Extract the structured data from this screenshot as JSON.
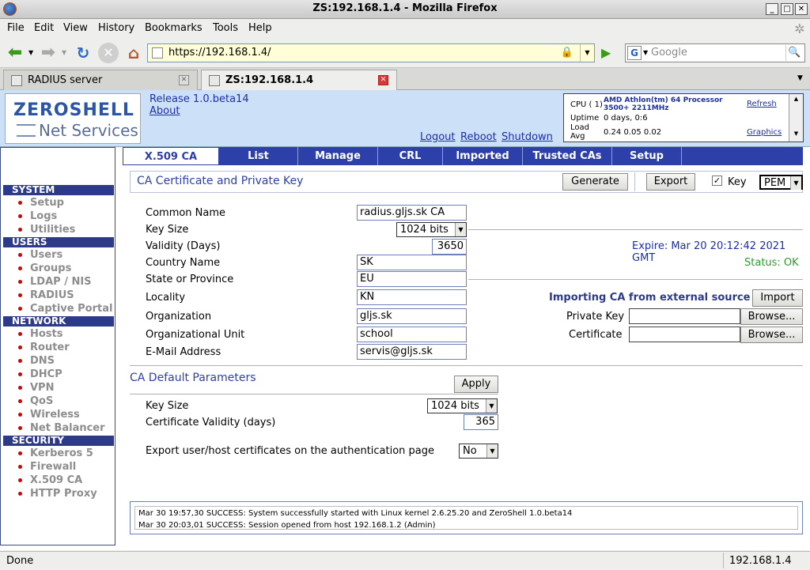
{
  "window": {
    "title": "ZS:192.168.1.4 - Mozilla Firefox"
  },
  "menubar": [
    "File",
    "Edit",
    "View",
    "History",
    "Bookmarks",
    "Tools",
    "Help"
  ],
  "navbar": {
    "url": "https://192.168.1.4/",
    "search_placeholder": "Google"
  },
  "tabs": [
    {
      "label": "RADIUS server"
    },
    {
      "label": "ZS:192.168.1.4"
    }
  ],
  "header": {
    "logo_line1": "ZEROSHELL",
    "logo_line2": "Net Services",
    "release": "Release 1.0.beta14",
    "about": "About",
    "logout": "Logout",
    "reboot": "Reboot",
    "shutdown": "Shutdown",
    "cpu_label": "CPU ( 1)",
    "cpu_value": "AMD Athlon(tm) 64 Processor 3500+ 2211MHz",
    "uptime_label": "Uptime",
    "uptime_value": "0 days, 0:6",
    "load_label": "Load Avg",
    "load_value": "0.24 0.05 0.02",
    "refresh": "Refresh",
    "graphics": "Graphics"
  },
  "sidebar": {
    "sections": [
      {
        "title": "SYSTEM",
        "items": [
          "Setup",
          "Logs",
          "Utilities"
        ]
      },
      {
        "title": "USERS",
        "items": [
          "Users",
          "Groups",
          "LDAP / NIS",
          "RADIUS",
          "Captive Portal"
        ]
      },
      {
        "title": "NETWORK",
        "items": [
          "Hosts",
          "Router",
          "DNS",
          "DHCP",
          "VPN",
          "QoS",
          "Wireless",
          "Net Balancer"
        ]
      },
      {
        "title": "SECURITY",
        "items": [
          "Kerberos 5",
          "Firewall",
          "X.509 CA",
          "HTTP Proxy"
        ]
      }
    ]
  },
  "ca_tabs": [
    "X.509 CA",
    "List",
    "Manage",
    "CRL",
    "Imported",
    "Trusted CAs",
    "Setup"
  ],
  "ca_section": {
    "title": "CA Certificate and Private Key",
    "generate": "Generate",
    "export": "Export",
    "key_label": "Key",
    "key_checked": "✓",
    "format": "PEM"
  },
  "form": {
    "common_name_label": "Common Name",
    "common_name": "radius.gljs.sk CA",
    "key_size_label": "Key Size",
    "key_size": "1024 bits",
    "validity_label": "Validity (Days)",
    "validity": "3650",
    "country_label": "Country Name",
    "country": "SK",
    "state_label": "State or Province",
    "state": "EU",
    "locality_label": "Locality",
    "locality": "KN",
    "org_label": "Organization",
    "org": "gljs.sk",
    "org_unit_label": "Organizational Unit",
    "org_unit": "school",
    "email_label": "E-Mail Address",
    "email": "servis@gljs.sk"
  },
  "status": {
    "expire": "Expire: Mar 20 20:12:42 2021 GMT",
    "status": "Status: OK"
  },
  "import": {
    "title": "Importing CA from external source",
    "import_button": "Import",
    "private_key_label": "Private Key",
    "certificate_label": "Certificate",
    "browse": "Browse..."
  },
  "defaults": {
    "title": "CA Default Parameters",
    "apply": "Apply",
    "key_size_label": "Key Size",
    "key_size": "1024 bits",
    "cert_validity_label": "Certificate Validity (days)",
    "cert_validity": "365",
    "export_label": "Export user/host certificates on the authentication page",
    "export_value": "No"
  },
  "log": [
    "Mar 30 19:57,30 SUCCESS: System successfully started with Linux kernel 2.6.25.20 and ZeroShell 1.0.beta14",
    "Mar 30 20:03,01 SUCCESS: Session opened from host 192.168.1.2 (Admin)"
  ],
  "statusbar": {
    "left": "Done",
    "right": "192.168.1.4"
  }
}
